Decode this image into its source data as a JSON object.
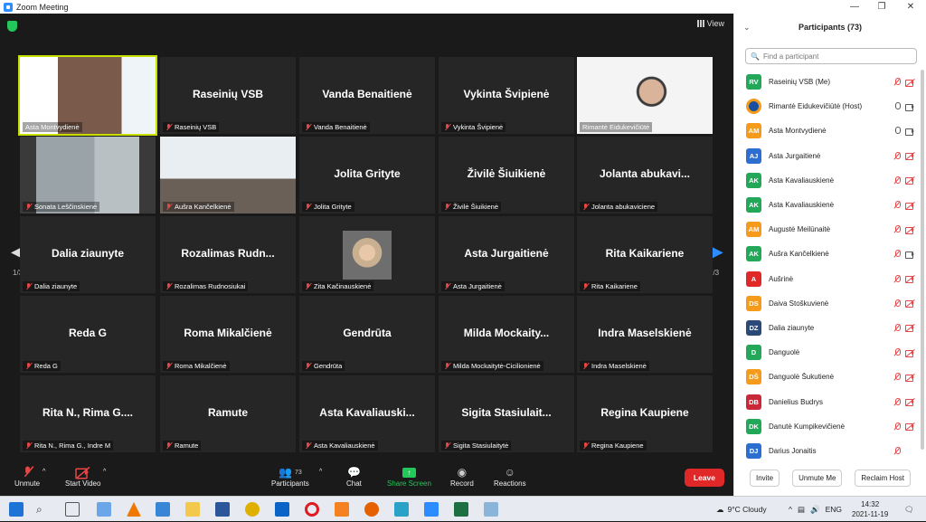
{
  "window": {
    "title": "Zoom Meeting"
  },
  "meeting": {
    "view_label": "View",
    "page_indicator": "1/3",
    "tiles": [
      {
        "display": "",
        "label": "Asta Montvydienė",
        "video": "slide",
        "active": true
      },
      {
        "display": "Raseinių VSB",
        "label": "Raseinių VSB"
      },
      {
        "display": "Vanda Benaitienė",
        "label": "Vanda Benaitienė"
      },
      {
        "display": "Vykinta Švipienė",
        "label": "Vykinta Švipienė"
      },
      {
        "display": "",
        "label": "Rimantė Eidukevičiūtė",
        "video": "person"
      },
      {
        "display": "",
        "label": "Sonata Leščinskienė",
        "video": "room"
      },
      {
        "display": "",
        "label": "Aušra Kančelkienė",
        "video": "room2"
      },
      {
        "display": "Jolita Grityte",
        "label": "Jolita Grityte"
      },
      {
        "display": "Živilė Šiuikienė",
        "label": "Živilė Šiuikienė"
      },
      {
        "display": "Jolanta abukavi...",
        "label": "Jolanta abukaviciene"
      },
      {
        "display": "Dalia ziaunyte",
        "label": "Dalia ziaunyte"
      },
      {
        "display": "Rozalimas Rudn...",
        "label": "Rozalimas Rudnosiukai"
      },
      {
        "display": "",
        "label": "Zita Kačinauskienė",
        "video": "small"
      },
      {
        "display": "Asta Jurgaitienė",
        "label": "Asta Jurgaitienė"
      },
      {
        "display": "Rita Kaikariene",
        "label": "Rita Kaikariene"
      },
      {
        "display": "Reda G",
        "label": "Reda G"
      },
      {
        "display": "Roma Mikalčienė",
        "label": "Roma Mikalčienė"
      },
      {
        "display": "Gendrūta",
        "label": "Gendrūta"
      },
      {
        "display": "Milda Mockaity...",
        "label": "Milda Mockaitytė-Cicilionienė"
      },
      {
        "display": "Indra Maselskienė",
        "label": "Indra Maselskienė"
      },
      {
        "display": "Rita N., Rima G....",
        "label": "Rita N., Rima G., Indre M"
      },
      {
        "display": "Ramute",
        "label": "Ramute"
      },
      {
        "display": "Asta Kavaliauski...",
        "label": "Asta Kavaliauskienė"
      },
      {
        "display": "Sigita Stasiulait...",
        "label": "Sigita Stasiulaitytė"
      },
      {
        "display": "Regina Kaupiene",
        "label": "Regina Kaupiene"
      }
    ]
  },
  "toolbar": {
    "unmute": "Unmute",
    "start_video": "Start Video",
    "participants": "Participants",
    "participants_count": "73",
    "chat": "Chat",
    "share_screen": "Share Screen",
    "record": "Record",
    "reactions": "Reactions",
    "leave": "Leave"
  },
  "panel": {
    "title": "Participants (73)",
    "search_placeholder": "Find a participant",
    "participants": [
      {
        "initials": "RV",
        "name": "Raseinių VSB (Me)",
        "color": "#23a85a",
        "mic": "off",
        "cam": "off"
      },
      {
        "initials": "",
        "name": "Rimantė Eidukevičiūtė (Host)",
        "color": "#1a4fa0",
        "mic": "on",
        "cam": "on"
      },
      {
        "initials": "AM",
        "name": "Asta Montvydienė",
        "color": "#f59a1b",
        "mic": "on",
        "cam": "on"
      },
      {
        "initials": "AJ",
        "name": "Asta Jurgaitienė",
        "color": "#2d6fd0",
        "mic": "off",
        "cam": "off"
      },
      {
        "initials": "AK",
        "name": "Asta Kavaliauskienė",
        "color": "#23a85a",
        "mic": "off",
        "cam": "off"
      },
      {
        "initials": "AK",
        "name": "Asta Kavaliauskienė",
        "color": "#23a85a",
        "mic": "off",
        "cam": "off"
      },
      {
        "initials": "AM",
        "name": "Augustė Meilūnaitė",
        "color": "#f59a1b",
        "mic": "off",
        "cam": "off"
      },
      {
        "initials": "AK",
        "name": "Aušra Kančelkienė",
        "color": "#23a85a",
        "mic": "off",
        "cam": "on"
      },
      {
        "initials": "A",
        "name": "Aušrinė",
        "color": "#e02828",
        "mic": "off",
        "cam": "off"
      },
      {
        "initials": "DS",
        "name": "Daiva Stoškuvienė",
        "color": "#f59a1b",
        "mic": "off",
        "cam": "off"
      },
      {
        "initials": "DZ",
        "name": "Dalia ziaunyte",
        "color": "#2b4a78",
        "mic": "off",
        "cam": "off"
      },
      {
        "initials": "D",
        "name": "Danguolė",
        "color": "#23a85a",
        "mic": "off",
        "cam": "off"
      },
      {
        "initials": "DŠ",
        "name": "Danguolė Šukutienė",
        "color": "#f59a1b",
        "mic": "off",
        "cam": "off"
      },
      {
        "initials": "DB",
        "name": "Danielius Budrys",
        "color": "#c8283a",
        "mic": "off",
        "cam": "off"
      },
      {
        "initials": "DK",
        "name": "Danutė Kumpikevičienė",
        "color": "#23a85a",
        "mic": "off",
        "cam": "off"
      },
      {
        "initials": "DJ",
        "name": "Darius Jonaitis",
        "color": "#2d6fd0",
        "mic": "off",
        "cam": "none"
      }
    ],
    "invite": "Invite",
    "unmute_me": "Unmute Me",
    "reclaim_host": "Reclaim Host"
  },
  "taskbar": {
    "weather": "9°C  Cloudy",
    "lang": "ENG",
    "time": "14:32",
    "date": "2021-11-19"
  }
}
